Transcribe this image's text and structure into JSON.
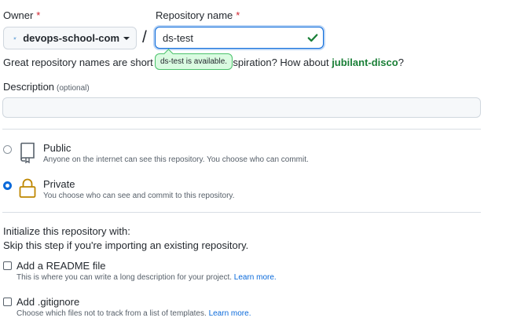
{
  "owner": {
    "label": "Owner",
    "required": "*",
    "value": "devops-school-com"
  },
  "repo": {
    "label": "Repository name",
    "required": "*",
    "value": "ds-test",
    "availability": "ds-test is available."
  },
  "hint": {
    "prefix": "Great repository names are short and",
    "mid": "inspiration? How about",
    "suggestion": "jubilant-disco",
    "suffix": "?"
  },
  "description": {
    "label": "Description",
    "optional": "(optional)",
    "value": ""
  },
  "visibility": {
    "public": {
      "title": "Public",
      "desc": "Anyone on the internet can see this repository. You choose who can commit.",
      "selected": false
    },
    "private": {
      "title": "Private",
      "desc": "You choose who can see and commit to this repository.",
      "selected": true
    }
  },
  "init": {
    "heading": "Initialize this repository with:",
    "sub": "Skip this step if you're importing an existing repository.",
    "readme": {
      "label": "Add a README file",
      "desc": "This is where you can write a long description for your project.",
      "link": "Learn more."
    },
    "gitignore": {
      "label": "Add .gitignore",
      "desc": "Choose which files not to track from a list of templates.",
      "link": "Learn more."
    }
  },
  "colors": {
    "accent": "#0969da",
    "success": "#1a7f37",
    "danger": "#cf222e",
    "lock": "#bf8700"
  }
}
